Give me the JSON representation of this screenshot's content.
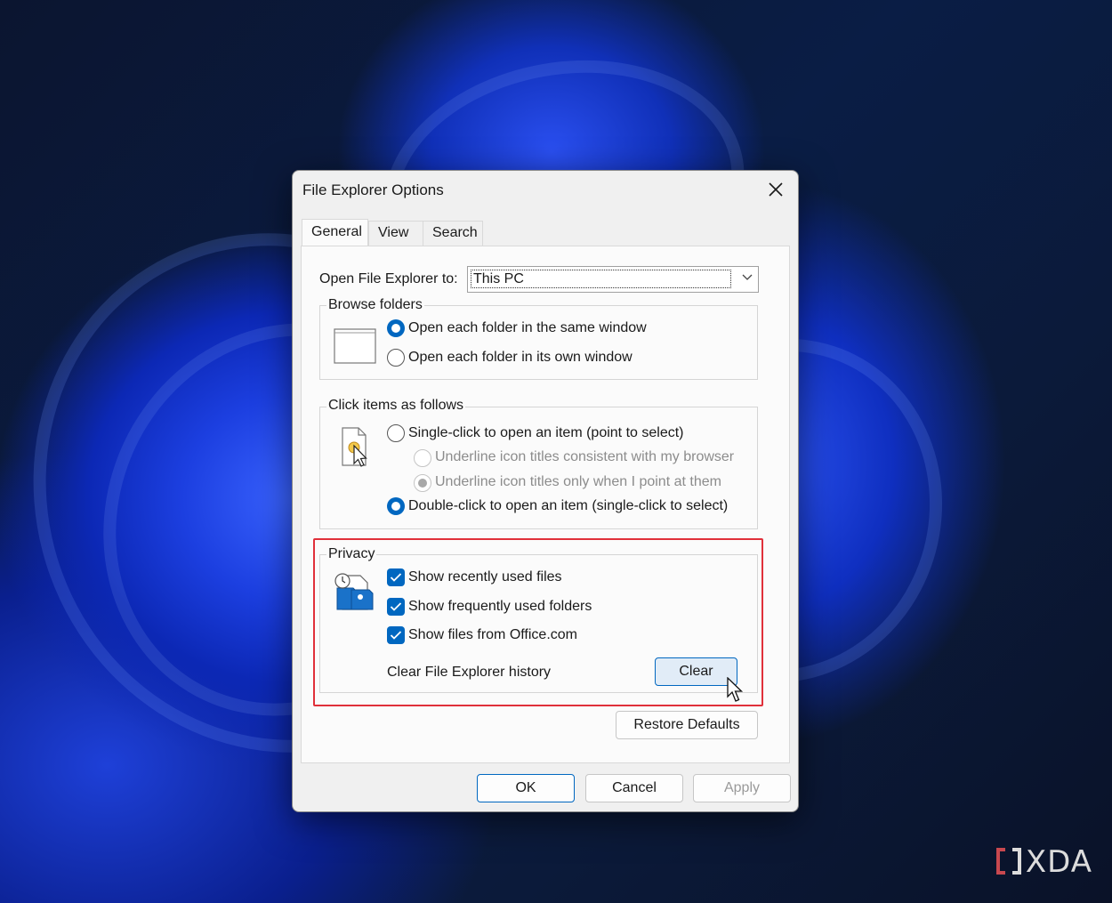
{
  "window": {
    "title": "File Explorer Options"
  },
  "tabs": [
    {
      "label": "General",
      "active": true
    },
    {
      "label": "View",
      "active": false
    },
    {
      "label": "Search",
      "active": false
    }
  ],
  "general": {
    "open_to_label": "Open File Explorer to:",
    "open_to_value": "This PC",
    "browse_folders": {
      "title": "Browse folders",
      "options": [
        {
          "label": "Open each folder in the same window",
          "selected": true
        },
        {
          "label": "Open each folder in its own window",
          "selected": false
        }
      ]
    },
    "click_items": {
      "title": "Click items as follows",
      "single_click": "Single-click to open an item (point to select)",
      "underline_consistent": "Underline icon titles consistent with my browser",
      "underline_point": "Underline icon titles only when I point at them",
      "double_click": "Double-click to open an item (single-click to select)"
    },
    "privacy": {
      "title": "Privacy",
      "checks": [
        {
          "label": "Show recently used files",
          "checked": true
        },
        {
          "label": "Show frequently used folders",
          "checked": true
        },
        {
          "label": "Show files from Office.com",
          "checked": true
        }
      ],
      "clear_history_label": "Clear File Explorer history",
      "clear_button": "Clear"
    },
    "restore_defaults": "Restore Defaults"
  },
  "footer": {
    "ok": "OK",
    "cancel": "Cancel",
    "apply": "Apply"
  },
  "watermark": {
    "brand": "XDA"
  },
  "colors": {
    "accent": "#0067c0",
    "highlight": "#e0303a"
  }
}
